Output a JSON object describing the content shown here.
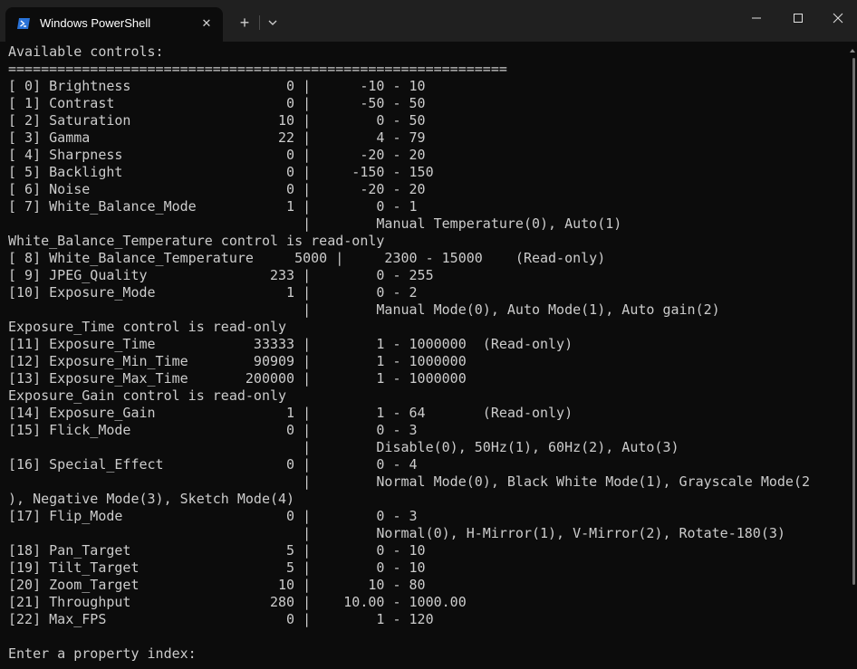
{
  "window": {
    "tab_title": "Windows PowerShell",
    "tab_icon": "powershell-icon",
    "tab_close_icon": "close-icon",
    "new_tab_label": "+",
    "dropdown_icon": "chevron-down-icon",
    "controls": [
      "minimize-icon",
      "maximize-icon",
      "close-icon"
    ],
    "accent_color": "#2a73d9"
  },
  "terminal": {
    "lines": [
      "Available controls:",
      "=============================================================",
      "[ 0] Brightness                   0 |      -10 - 10",
      "[ 1] Contrast                     0 |      -50 - 50",
      "[ 2] Saturation                  10 |        0 - 50",
      "[ 3] Gamma                       22 |        4 - 79",
      "[ 4] Sharpness                    0 |      -20 - 20",
      "[ 5] Backlight                    0 |     -150 - 150",
      "[ 6] Noise                        0 |      -20 - 20",
      "[ 7] White_Balance_Mode           1 |        0 - 1",
      "                                    |        Manual Temperature(0), Auto(1)",
      "White_Balance_Temperature control is read-only",
      "[ 8] White_Balance_Temperature     5000 |     2300 - 15000    (Read-only)",
      "[ 9] JPEG_Quality               233 |        0 - 255",
      "[10] Exposure_Mode                1 |        0 - 2",
      "                                    |        Manual Mode(0), Auto Mode(1), Auto gain(2)",
      "Exposure_Time control is read-only",
      "[11] Exposure_Time            33333 |        1 - 1000000  (Read-only)",
      "[12] Exposure_Min_Time        90909 |        1 - 1000000",
      "[13] Exposure_Max_Time       200000 |        1 - 1000000",
      "Exposure_Gain control is read-only",
      "[14] Exposure_Gain                1 |        1 - 64       (Read-only)",
      "[15] Flick_Mode                   0 |        0 - 3",
      "                                    |        Disable(0), 50Hz(1), 60Hz(2), Auto(3)",
      "[16] Special_Effect               0 |        0 - 4",
      "                                    |        Normal Mode(0), Black White Mode(1), Grayscale Mode(2",
      "), Negative Mode(3), Sketch Mode(4)",
      "[17] Flip_Mode                    0 |        0 - 3",
      "                                    |        Normal(0), H-Mirror(1), V-Mirror(2), Rotate-180(3)",
      "[18] Pan_Target                   5 |        0 - 10",
      "[19] Tilt_Target                  5 |        0 - 10",
      "[20] Zoom_Target                 10 |       10 - 80",
      "[21] Throughput                 280 |    10.00 - 1000.00",
      "[22] Max_FPS                      0 |        1 - 120",
      "",
      "Enter a property index:"
    ]
  }
}
